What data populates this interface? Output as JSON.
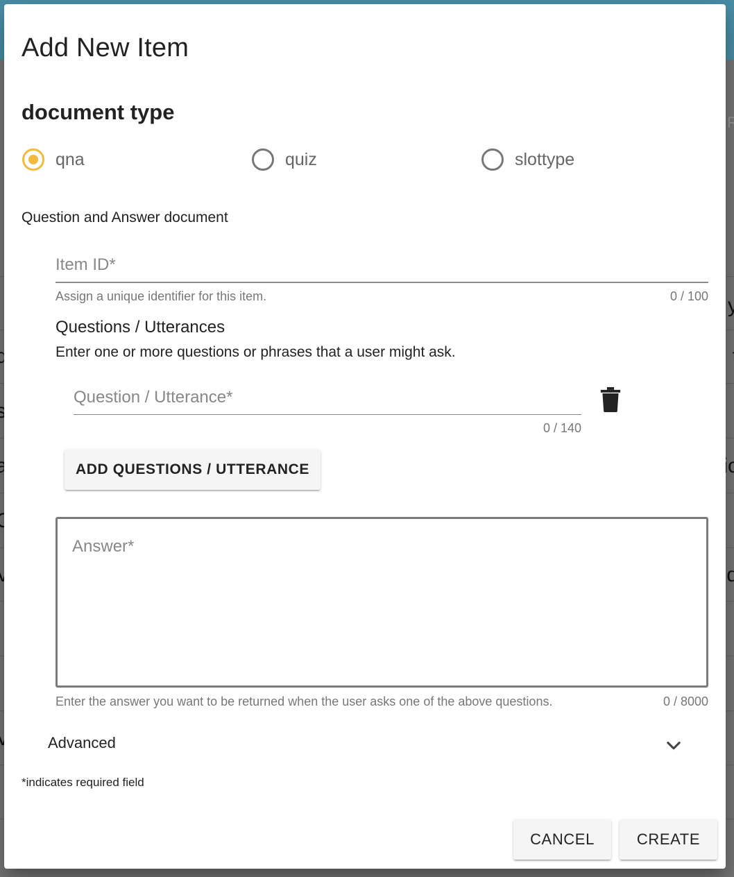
{
  "dialog": {
    "title": "Add New Item",
    "section_title": "document type",
    "radios": [
      {
        "label": "qna",
        "checked": true
      },
      {
        "label": "quiz",
        "checked": false
      },
      {
        "label": "slottype",
        "checked": false
      }
    ],
    "doc_description": "Question and Answer document",
    "item_id": {
      "placeholder": "Item ID*",
      "hint": "Assign a unique identifier for this item.",
      "counter": "0 / 100"
    },
    "questions": {
      "heading": "Questions / Utterances",
      "description": "Enter one or more questions or phrases that a user might ask.",
      "field_placeholder": "Question / Utterance*",
      "counter": "0 / 140",
      "add_button": "ADD QUESTIONS / UTTERANCE"
    },
    "answer": {
      "placeholder": "Answer*",
      "hint": "Enter the answer you want to be returned when the user asks one of the above questions.",
      "counter": "0 / 8000"
    },
    "advanced_label": "Advanced",
    "required_note": "*indicates required field",
    "cancel_label": "CANCEL",
    "create_label": "CREATE"
  },
  "colors": {
    "accent": "#f2bb3c",
    "topbar": "#4a8fa8"
  },
  "background_fragments": {
    "left": [
      "I",
      "q",
      "s",
      "a",
      "C",
      "V",
      "V"
    ],
    "right": [
      "R",
      "y",
      "t",
      "ic",
      "d"
    ]
  }
}
